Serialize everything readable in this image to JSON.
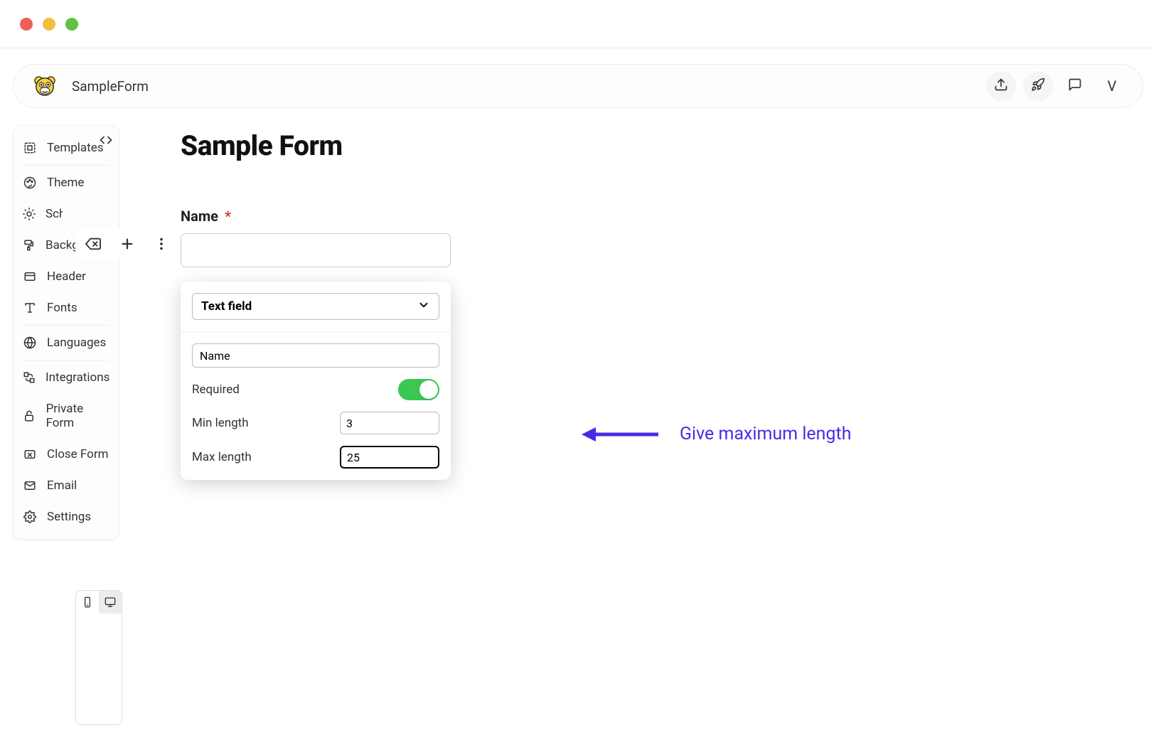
{
  "header": {
    "app_name": "SampleForm",
    "avatar_letter": "V"
  },
  "sidebar": {
    "items": [
      {
        "label": "Templates"
      },
      {
        "label": "Theme"
      },
      {
        "label": "Sch"
      },
      {
        "label": "Background"
      },
      {
        "label": "Header"
      },
      {
        "label": "Fonts"
      },
      {
        "label": "Languages"
      },
      {
        "label": "Integrations"
      },
      {
        "label": "Private Form"
      },
      {
        "label": "Close Form"
      },
      {
        "label": "Email"
      },
      {
        "label": "Settings"
      }
    ]
  },
  "canvas": {
    "title": "Sample Form"
  },
  "field": {
    "label": "Name",
    "required_marker": "*",
    "value": ""
  },
  "settings": {
    "type_label": "Text field",
    "name_value": "Name",
    "required_label": "Required",
    "required_on": true,
    "min_length_label": "Min length",
    "min_length_value": "3",
    "max_length_label": "Max length",
    "max_length_value": "25"
  },
  "annotation": {
    "text": "Give maximum length"
  },
  "colors": {
    "accent_annotation": "#4a2ae6",
    "toggle_on": "#3ac753",
    "required": "#d33a2c"
  }
}
